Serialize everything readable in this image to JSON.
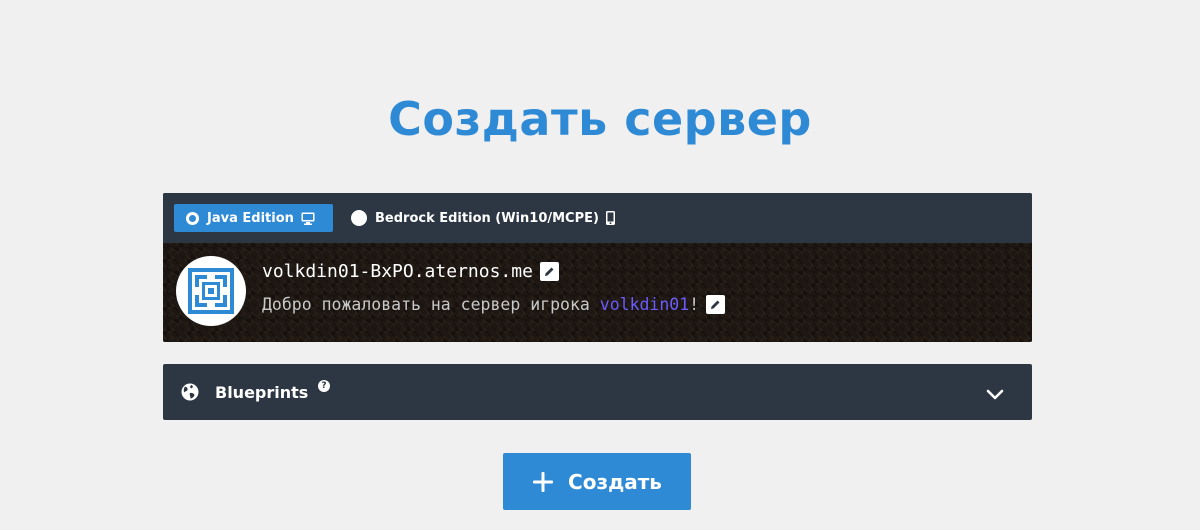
{
  "page": {
    "title": "Создать сервер"
  },
  "editions": [
    {
      "label": "Java Edition",
      "selected": true,
      "icon": "desktop-icon"
    },
    {
      "label": "Bedrock Edition (Win10/MCPE)",
      "selected": false,
      "icon": "mobile-icon"
    }
  ],
  "server": {
    "address": "volkdin01-BxPO.aternos.me",
    "motd_prefix": "Добро пожаловать на сервер игрока ",
    "motd_player": "volkdin01",
    "motd_suffix": "!"
  },
  "blueprints": {
    "label": "Blueprints",
    "help": "?"
  },
  "create_button": {
    "label": "Создать"
  },
  "colors": {
    "accent": "#2f8ad6",
    "panel": "#2c3743",
    "background": "#f0f0f1",
    "player_name": "#6b5cff"
  }
}
